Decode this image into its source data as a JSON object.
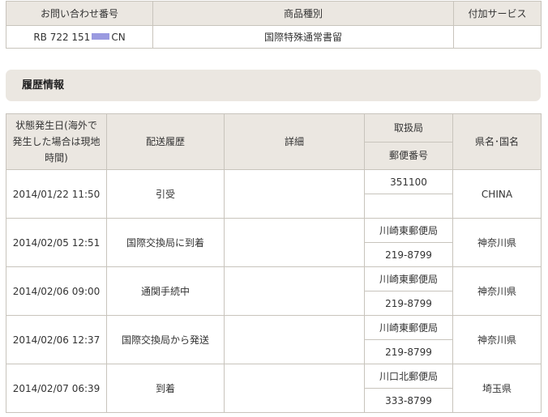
{
  "summary": {
    "headers": [
      "お問い合わせ番号",
      "商品種別",
      "付加サービス"
    ],
    "tracking_prefix": "RB 722 151",
    "tracking_suffix": "CN",
    "product_type": "国際特殊通常書留",
    "additional_service": "",
    "mask_color": "#9a9ae0"
  },
  "history": {
    "title": "履歴情報",
    "headers": {
      "date_line1": "状態発生日(海外で",
      "date_line2": "発生した場合は現地",
      "date_line3": "時間)",
      "status": "配送履歴",
      "detail": "詳細",
      "office": "取扱局",
      "postcode": "郵便番号",
      "region": "県名･国名"
    },
    "rows": [
      {
        "date": "2014/01/22 11:50",
        "status": "引受",
        "detail": "",
        "office": "351100",
        "postcode": "",
        "region": "CHINA"
      },
      {
        "date": "2014/02/05 12:51",
        "status": "国際交換局に到着",
        "detail": "",
        "office": "川崎東郵便局",
        "postcode": "219-8799",
        "region": "神奈川県"
      },
      {
        "date": "2014/02/06 09:00",
        "status": "通関手続中",
        "detail": "",
        "office": "川崎東郵便局",
        "postcode": "219-8799",
        "region": "神奈川県"
      },
      {
        "date": "2014/02/06 12:37",
        "status": "国際交換局から発送",
        "detail": "",
        "office": "川崎東郵便局",
        "postcode": "219-8799",
        "region": "神奈川県"
      },
      {
        "date": "2014/02/07 06:39",
        "status": "到着",
        "detail": "",
        "office": "川口北郵便局",
        "postcode": "333-8799",
        "region": "埼玉県"
      }
    ]
  },
  "colors": {
    "header_bg": "#ebe7e1",
    "border": "#c8c4bc",
    "text": "#333333"
  }
}
